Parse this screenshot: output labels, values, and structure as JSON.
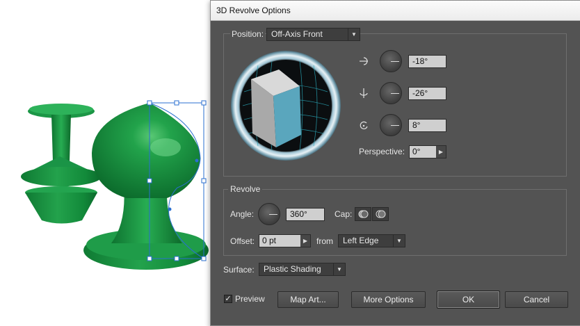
{
  "dialog": {
    "title": "3D Revolve Options",
    "position": {
      "label": "Position:",
      "value": "Off-Axis Front",
      "x_axis_value": "-18°",
      "y_axis_value": "-26°",
      "z_axis_value": "8°",
      "perspective_label": "Perspective:",
      "perspective_value": "0°"
    },
    "revolve": {
      "group_label": "Revolve",
      "angle_label": "Angle:",
      "angle_value": "360°",
      "cap_label": "Cap:",
      "offset_label": "Offset:",
      "offset_value": "0 pt",
      "from_label": "from",
      "from_value": "Left Edge"
    },
    "surface": {
      "label": "Surface:",
      "value": "Plastic Shading"
    },
    "footer": {
      "preview_label": "Preview",
      "preview_checked": true,
      "map_art_button": "Map Art...",
      "more_options_button": "More Options",
      "ok_button": "OK",
      "cancel_button": "Cancel"
    }
  },
  "colors": {
    "dialog_bg": "#535353",
    "object_green": "#1a9a45",
    "cube_front": "#5aa6bd",
    "selection_blue": "#2a6fd0"
  }
}
